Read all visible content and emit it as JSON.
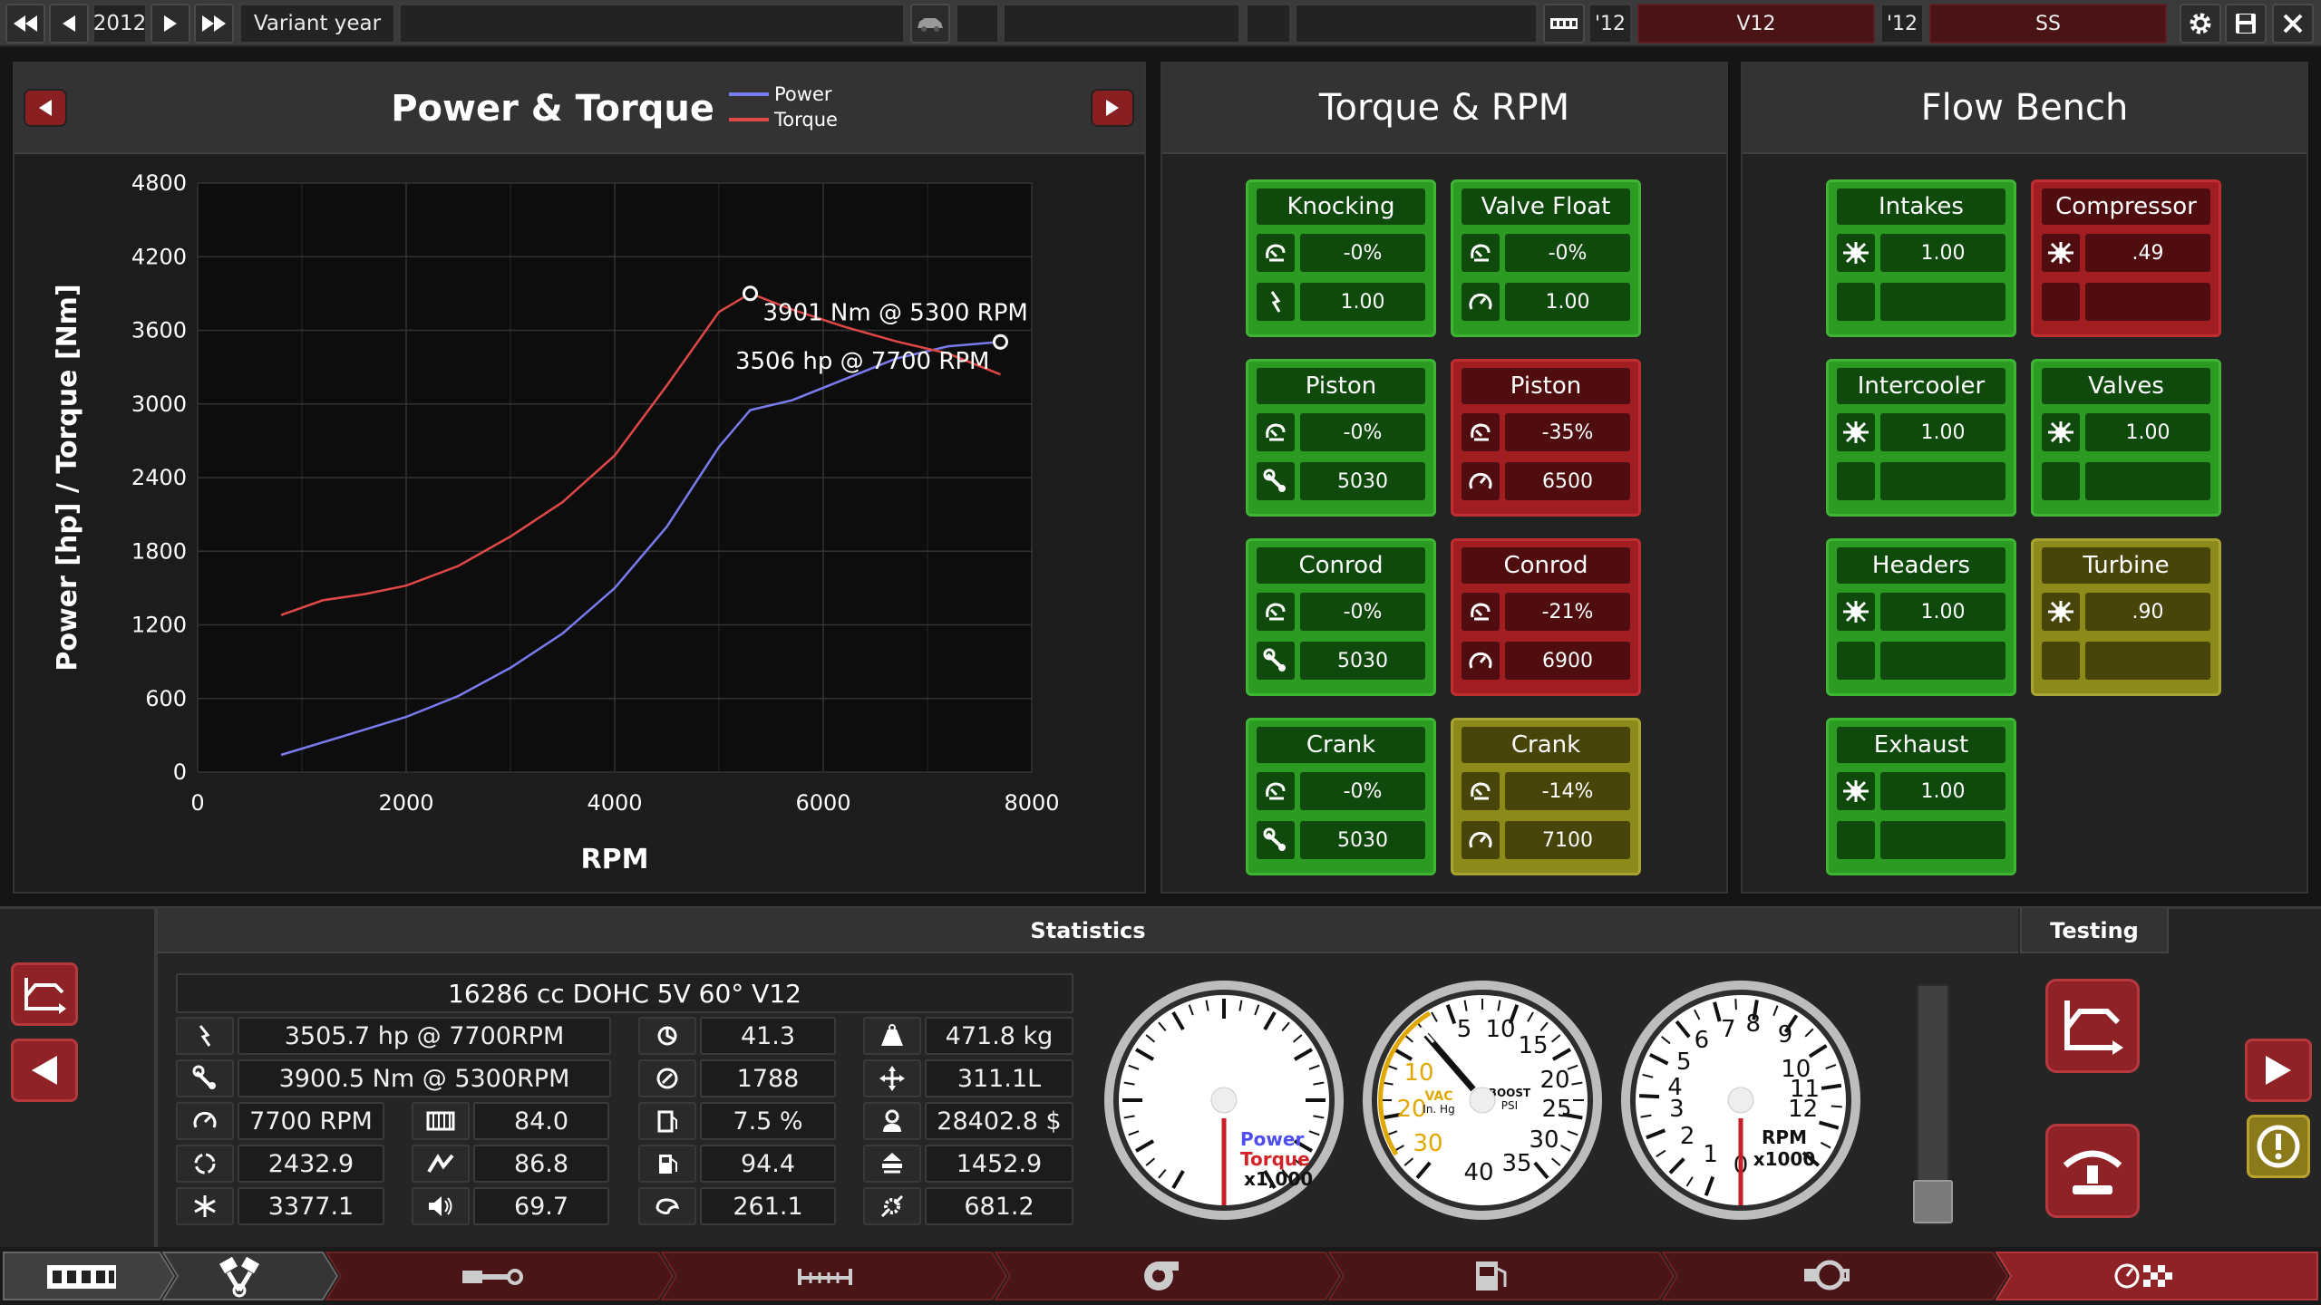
{
  "topbar": {
    "year": "2012",
    "variant_label": "Variant year",
    "engine_year": "'12",
    "engine_name": "V12",
    "variant_year": "'12",
    "variant_name": "SS"
  },
  "chart_panel": {
    "title": "Power & Torque",
    "legend": [
      {
        "name": "Power",
        "color": "#7b7bf0"
      },
      {
        "name": "Torque",
        "color": "#e04848"
      }
    ]
  },
  "chart_data": {
    "type": "line",
    "xlabel": "RPM",
    "ylabel": "Power [hp] / Torque [Nm]",
    "xlim": [
      0,
      8000
    ],
    "ylim": [
      0,
      4800
    ],
    "xticks": [
      "0",
      "2000",
      "4000",
      "6000",
      "8000"
    ],
    "yticks": [
      "0",
      "600",
      "1200",
      "1800",
      "2400",
      "3000",
      "3600",
      "4200",
      "4800"
    ],
    "grid": true,
    "series": [
      {
        "name": "Power",
        "color": "#7b7bf0",
        "x": [
          800,
          1500,
          2000,
          2500,
          3000,
          3500,
          4000,
          4500,
          5000,
          5300,
          5700,
          6200,
          6700,
          7200,
          7700
        ],
        "y": [
          140,
          320,
          450,
          620,
          850,
          1130,
          1500,
          2000,
          2650,
          2950,
          3030,
          3200,
          3370,
          3470,
          3506
        ]
      },
      {
        "name": "Torque",
        "color": "#e04848",
        "x": [
          800,
          1200,
          1600,
          2000,
          2500,
          3000,
          3500,
          4000,
          4500,
          5000,
          5300,
          5700,
          6200,
          6700,
          7200,
          7700
        ],
        "y": [
          1280,
          1400,
          1450,
          1520,
          1680,
          1920,
          2200,
          2580,
          3150,
          3750,
          3901,
          3770,
          3630,
          3510,
          3410,
          3240
        ]
      }
    ],
    "annotations": [
      {
        "text": "3901 Nm @ 5300 RPM",
        "x": 5300,
        "y": 3901,
        "series": "Torque"
      },
      {
        "text": "3506 hp @ 7700 RPM",
        "x": 7700,
        "y": 3506,
        "series": "Power"
      }
    ]
  },
  "torque_panel": {
    "title": "Torque & RPM",
    "cards": [
      {
        "title": "Knocking",
        "v1": "-0%",
        "v2": "1.00",
        "icon1": "gauge-icon",
        "icon2": "spark-icon",
        "color": "green"
      },
      {
        "title": "Valve Float",
        "v1": "-0%",
        "v2": "1.00",
        "icon1": "gauge-icon",
        "icon2": "rpm-icon",
        "color": "green"
      },
      {
        "title": "Piston",
        "v1": "-0%",
        "v2": "5030",
        "icon1": "gauge-icon",
        "icon2": "wrench-icon",
        "color": "green"
      },
      {
        "title": "Piston",
        "v1": "-35%",
        "v2": "6500",
        "icon1": "gauge-icon",
        "icon2": "rpm-icon",
        "color": "red"
      },
      {
        "title": "Conrod",
        "v1": "-0%",
        "v2": "5030",
        "icon1": "gauge-icon",
        "icon2": "wrench-icon",
        "color": "green"
      },
      {
        "title": "Conrod",
        "v1": "-21%",
        "v2": "6900",
        "icon1": "gauge-icon",
        "icon2": "rpm-icon",
        "color": "red"
      },
      {
        "title": "Crank",
        "v1": "-0%",
        "v2": "5030",
        "icon1": "gauge-icon",
        "icon2": "wrench-icon",
        "color": "green"
      },
      {
        "title": "Crank",
        "v1": "-14%",
        "v2": "7100",
        "icon1": "gauge-icon",
        "icon2": "rpm-icon",
        "color": "yellow"
      }
    ]
  },
  "flow_panel": {
    "title": "Flow Bench",
    "cards": [
      {
        "title": "Intakes",
        "v1": "1.00",
        "color": "green"
      },
      {
        "title": "Compressor",
        "v1": ".49",
        "color": "red"
      },
      {
        "title": "Intercooler",
        "v1": "1.00",
        "color": "green"
      },
      {
        "title": "Valves",
        "v1": "1.00",
        "color": "green"
      },
      {
        "title": "Headers",
        "v1": "1.00",
        "color": "green"
      },
      {
        "title": "Turbine",
        "v1": ".90",
        "color": "yellow"
      },
      {
        "title": "Exhaust",
        "v1": "1.00",
        "color": "green"
      }
    ]
  },
  "statistics": {
    "title": "Statistics",
    "testing_title": "Testing",
    "engine_desc": "16286 cc DOHC 5V 60° V12",
    "power": "3505.7 hp @ 7700RPM",
    "torque": "3900.5 Nm @ 5300RPM",
    "rpm": "7700 RPM",
    "c1": [
      "2432.9",
      "3377.1"
    ],
    "c2": [
      "84.0",
      "86.8",
      "69.7"
    ],
    "c3": [
      "41.3",
      "1788",
      "7.5 %",
      "94.4",
      "261.1"
    ],
    "c4": [
      "471.8 kg",
      "311.1L",
      "28402.8 $",
      "1452.9",
      "681.2"
    ]
  },
  "gauges": {
    "g1": {
      "label1": "Power",
      "label2": "Torque",
      "label3": "x1,000"
    },
    "g2": {
      "nums_black": [
        "5",
        "10",
        "15",
        "20",
        "25",
        "30",
        "35",
        "40"
      ],
      "nums_yellow": [
        "10",
        "20",
        "30"
      ],
      "vac_top": "VAC",
      "vac_bottom": "In. Hg",
      "boost_top": "BOOST",
      "boost_bottom": "PSI"
    },
    "g3": {
      "nums": [
        "0",
        "1",
        "2",
        "3",
        "4",
        "5",
        "6",
        "7",
        "8",
        "9",
        "10",
        "11",
        "12"
      ],
      "label1": "RPM",
      "label2": "x1000"
    }
  }
}
